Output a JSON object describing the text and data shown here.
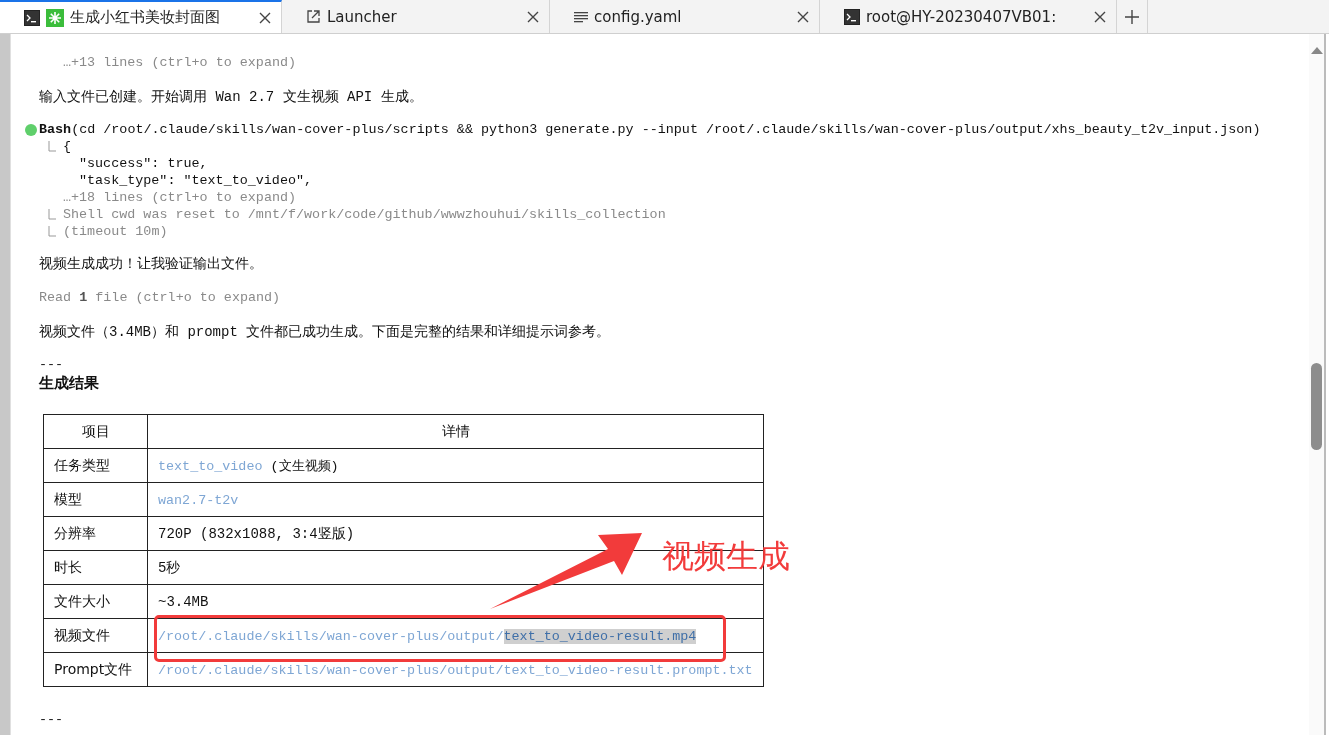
{
  "tabs": [
    {
      "label": "生成小红书美妆封面图",
      "kind": "agent",
      "selected": true
    },
    {
      "label": "Launcher",
      "kind": "launcher",
      "selected": false
    },
    {
      "label": "config.yaml",
      "kind": "file",
      "selected": false
    },
    {
      "label": "root@HY-20230407VB01:",
      "kind": "terminal",
      "selected": false
    }
  ],
  "transcript": [
    {
      "kind": "collapsed",
      "text": "…+13 lines (ctrl+o to expand)"
    },
    {
      "kind": "message",
      "text": "输入文件已创建。开始调用 Wan 2.7 文生视频 API 生成。"
    },
    {
      "kind": "tool",
      "name": "Bash",
      "args": "(cd /root/.claude/skills/wan-cover-plus/scripts && python3 generate.py --input /root/.claude/skills/wan-cover-plus/output/xhs_beauty_t2v_input.json)",
      "output": [
        {
          "kind": "first",
          "text": "{"
        },
        {
          "kind": "json",
          "text": "\"success\": true,"
        },
        {
          "kind": "json",
          "text": "\"task_type\": \"text_to_video\","
        },
        {
          "kind": "more",
          "text": "…+18 lines (ctrl+o to expand)"
        },
        {
          "kind": "note",
          "text": "Shell cwd was reset to /mnt/f/work/code/github/wwwzhouhui/skills_collection"
        },
        {
          "kind": "note",
          "text": "(timeout 10m)"
        }
      ]
    },
    {
      "kind": "message",
      "text": "视频生成成功！让我验证输出文件。"
    },
    {
      "kind": "summary",
      "text": "Read **1** file (ctrl+o to expand)"
    },
    {
      "kind": "message",
      "text": "视频文件（3.4MB）和 prompt 文件都已成功生成。下面是完整的结果和详细提示词参考。"
    },
    {
      "kind": "rule",
      "text": "---"
    },
    {
      "kind": "heading",
      "text": "生成结果"
    },
    {
      "kind": "table",
      "columns": [
        "项目",
        "详情"
      ],
      "rows": [
        [
          [
            {
              "text": "任务类型"
            }
          ],
          [
            {
              "text": "text_to_video",
              "kind": "link"
            },
            {
              "text": " (文生视频)"
            }
          ]
        ],
        [
          [
            {
              "text": "模型"
            }
          ],
          [
            {
              "text": "wan2.7-t2v",
              "kind": "link"
            }
          ]
        ],
        [
          [
            {
              "text": "分辨率"
            }
          ],
          [
            {
              "text": "720P (832x1088, 3:4竖版)"
            }
          ]
        ],
        [
          [
            {
              "text": "时长"
            }
          ],
          [
            {
              "text": "5秒"
            }
          ]
        ],
        [
          [
            {
              "text": "文件大小"
            }
          ],
          [
            {
              "text": "~3.4MB"
            }
          ]
        ],
        [
          [
            {
              "text": "视频文件"
            }
          ],
          [
            {
              "text": "/root/.claude/skills/wan-cover-plus/output/",
              "kind": "link"
            },
            {
              "text": "text_to_video-result.mp4",
              "kind": "highlighted"
            }
          ]
        ],
        [
          [
            {
              "text": "Prompt文件"
            }
          ],
          [
            {
              "text": "/root/.claude/skills/wan-cover-plus/output/text_to_video-result.prompt.txt",
              "kind": "link"
            }
          ]
        ]
      ]
    },
    {
      "kind": "rule",
      "text": "---"
    }
  ],
  "annotation": {
    "text": "视频生成"
  }
}
